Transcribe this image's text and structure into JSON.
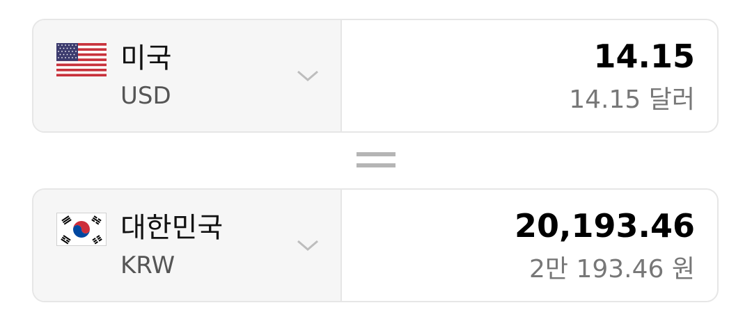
{
  "from": {
    "country": "미국",
    "code": "USD",
    "amount": "14.15",
    "amount_words": "14.15 달러",
    "flag_icon": "us-flag-icon"
  },
  "to": {
    "country": "대한민국",
    "code": "KRW",
    "amount": "20,193.46",
    "amount_words": "2만 193.46 원",
    "flag_icon": "kr-flag-icon"
  },
  "colors": {
    "border": "#e6e6e6",
    "select_bg": "#f6f6f6",
    "equals": "#b5b5b5",
    "secondary_text": "#777777"
  }
}
